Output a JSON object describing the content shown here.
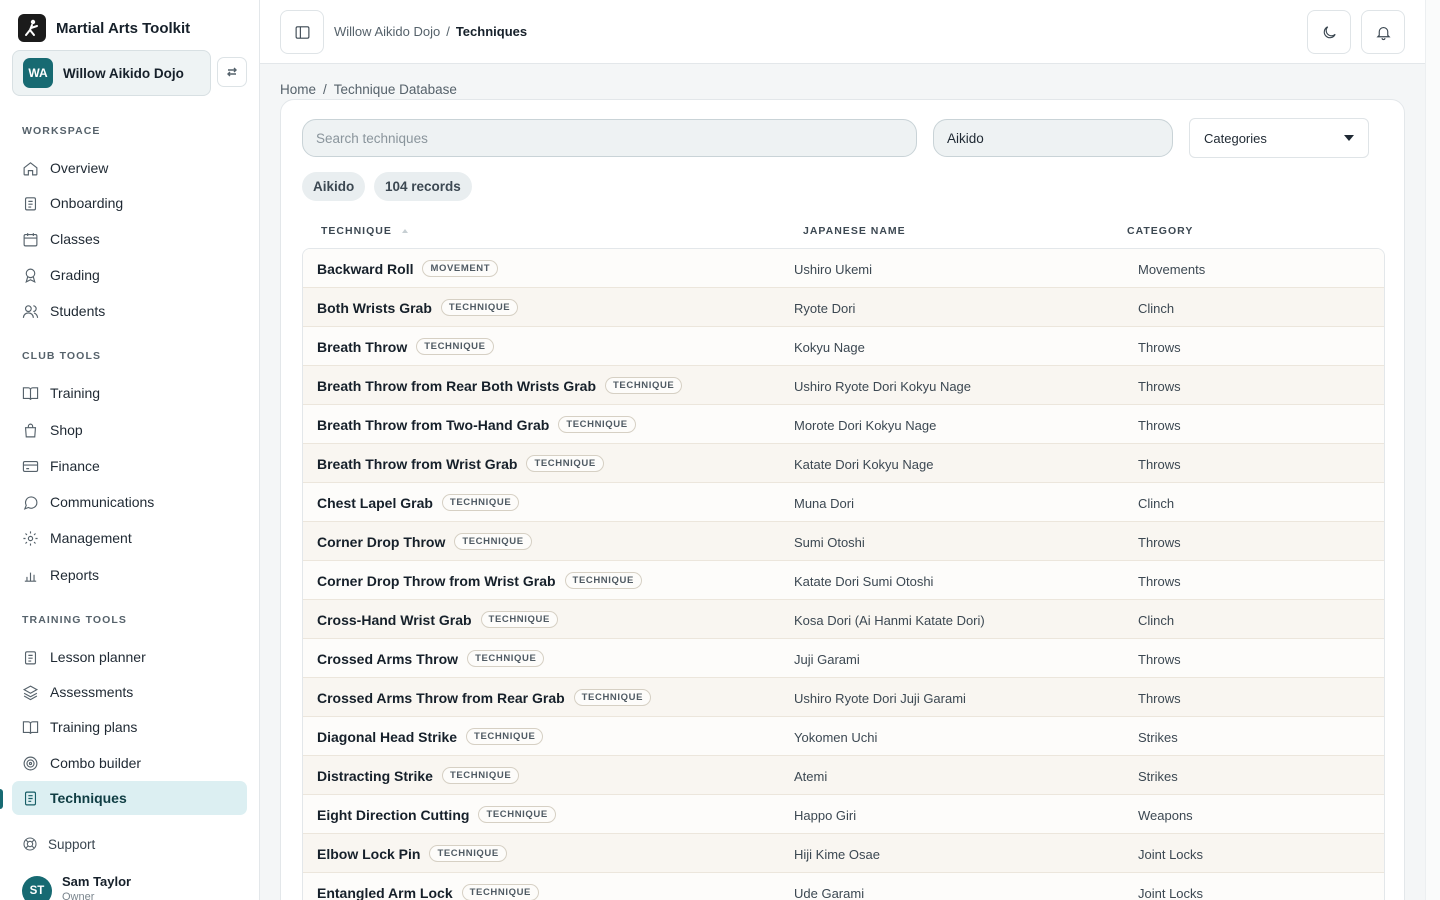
{
  "app": {
    "title": "Martial Arts Toolkit"
  },
  "org": {
    "initials": "WA",
    "name": "Willow Aikido Dojo"
  },
  "sidebar": {
    "workspace_label": "WORKSPACE",
    "workspace": [
      {
        "label": "Overview",
        "icon": "home-icon"
      },
      {
        "label": "Onboarding",
        "icon": "clipboard-icon"
      },
      {
        "label": "Classes",
        "icon": "calendar-icon"
      },
      {
        "label": "Grading",
        "icon": "award-icon"
      },
      {
        "label": "Students",
        "icon": "users-icon"
      }
    ],
    "club_label": "CLUB TOOLS",
    "club": [
      {
        "label": "Training",
        "icon": "book-icon"
      },
      {
        "label": "Shop",
        "icon": "shopping-bag-icon"
      },
      {
        "label": "Finance",
        "icon": "credit-card-icon"
      },
      {
        "label": "Communications",
        "icon": "message-icon"
      },
      {
        "label": "Management",
        "icon": "gear-icon"
      },
      {
        "label": "Reports",
        "icon": "bar-chart-icon"
      }
    ],
    "training_label": "TRAINING TOOLS",
    "training": [
      {
        "label": "Lesson planner",
        "icon": "clipboard-icon"
      },
      {
        "label": "Assessments",
        "icon": "layers-icon"
      },
      {
        "label": "Training plans",
        "icon": "book-icon"
      },
      {
        "label": "Combo builder",
        "icon": "target-icon"
      },
      {
        "label": "Techniques",
        "icon": "document-icon",
        "active": true
      }
    ],
    "support": "Support",
    "user": {
      "initials": "ST",
      "name": "Sam Taylor",
      "role": "Owner"
    }
  },
  "topbar": {
    "crumb_org": "Willow Aikido Dojo",
    "separator": "/",
    "crumb_current": "Techniques"
  },
  "breadcrumb": {
    "home": "Home",
    "separator": "/",
    "current": "Technique Database"
  },
  "filters": {
    "search_placeholder": "Search techniques",
    "style_value": "Aikido",
    "categories_label": "Categories"
  },
  "chips": {
    "style": "Aikido",
    "records": "104 records"
  },
  "table": {
    "headers": {
      "technique": "TECHNIQUE",
      "japanese": "JAPANESE NAME",
      "category": "CATEGORY"
    },
    "rows": [
      {
        "name": "Backward Roll",
        "badge": "MOVEMENT",
        "japanese": "Ushiro Ukemi",
        "category": "Movements"
      },
      {
        "name": "Both Wrists Grab",
        "badge": "TECHNIQUE",
        "japanese": "Ryote Dori",
        "category": "Clinch"
      },
      {
        "name": "Breath Throw",
        "badge": "TECHNIQUE",
        "japanese": "Kokyu Nage",
        "category": "Throws"
      },
      {
        "name": "Breath Throw from Rear Both Wrists Grab",
        "badge": "TECHNIQUE",
        "japanese": "Ushiro Ryote Dori Kokyu Nage",
        "category": "Throws"
      },
      {
        "name": "Breath Throw from Two-Hand Grab",
        "badge": "TECHNIQUE",
        "japanese": "Morote Dori Kokyu Nage",
        "category": "Throws"
      },
      {
        "name": "Breath Throw from Wrist Grab",
        "badge": "TECHNIQUE",
        "japanese": "Katate Dori Kokyu Nage",
        "category": "Throws"
      },
      {
        "name": "Chest Lapel Grab",
        "badge": "TECHNIQUE",
        "japanese": "Muna Dori",
        "category": "Clinch"
      },
      {
        "name": "Corner Drop Throw",
        "badge": "TECHNIQUE",
        "japanese": "Sumi Otoshi",
        "category": "Throws"
      },
      {
        "name": "Corner Drop Throw from Wrist Grab",
        "badge": "TECHNIQUE",
        "japanese": "Katate Dori Sumi Otoshi",
        "category": "Throws"
      },
      {
        "name": "Cross-Hand Wrist Grab",
        "badge": "TECHNIQUE",
        "japanese": "Kosa Dori (Ai Hanmi Katate Dori)",
        "category": "Clinch"
      },
      {
        "name": "Crossed Arms Throw",
        "badge": "TECHNIQUE",
        "japanese": "Juji Garami",
        "category": "Throws"
      },
      {
        "name": "Crossed Arms Throw from Rear Grab",
        "badge": "TECHNIQUE",
        "japanese": "Ushiro Ryote Dori Juji Garami",
        "category": "Throws"
      },
      {
        "name": "Diagonal Head Strike",
        "badge": "TECHNIQUE",
        "japanese": "Yokomen Uchi",
        "category": "Strikes"
      },
      {
        "name": "Distracting Strike",
        "badge": "TECHNIQUE",
        "japanese": "Atemi",
        "category": "Strikes"
      },
      {
        "name": "Eight Direction Cutting",
        "badge": "TECHNIQUE",
        "japanese": "Happo Giri",
        "category": "Weapons"
      },
      {
        "name": "Elbow Lock Pin",
        "badge": "TECHNIQUE",
        "japanese": "Hiji Kime Osae",
        "category": "Joint Locks"
      },
      {
        "name": "Entangled Arm Lock",
        "badge": "TECHNIQUE",
        "japanese": "Ude Garami",
        "category": "Joint Locks"
      }
    ]
  }
}
